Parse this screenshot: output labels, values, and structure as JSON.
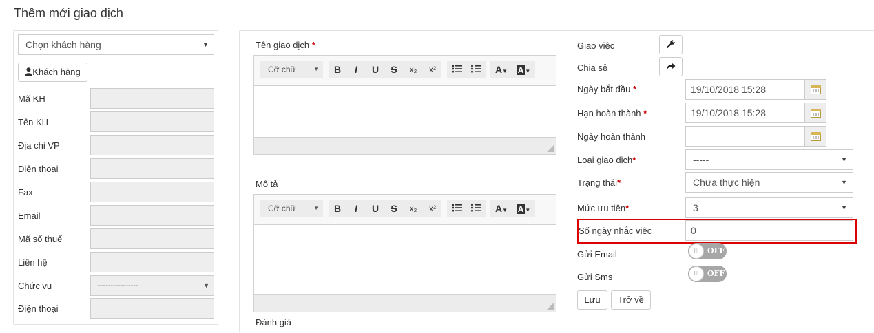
{
  "page": {
    "title": "Thêm mới giao dịch"
  },
  "customer": {
    "select_value": "Chọn khách hàng",
    "button_label": "Khách hàng",
    "fields": [
      {
        "label": "Mã KH"
      },
      {
        "label": "Tên KH"
      },
      {
        "label": "Địa chỉ VP"
      },
      {
        "label": "Điện thoại"
      },
      {
        "label": "Fax"
      },
      {
        "label": "Email"
      },
      {
        "label": "Mã số thuế"
      },
      {
        "label": "Liên hệ"
      },
      {
        "label": "Chức vụ",
        "value": "----------------"
      },
      {
        "label": "Điện thoại"
      }
    ]
  },
  "editors": {
    "name_label": "Tên giao dịch",
    "required_mark": "*",
    "desc_label": "Mô tả",
    "eval_label": "Đánh giá",
    "font_select": "Cỡ chữ",
    "tools": {
      "bold": "B",
      "italic": "I",
      "underline": "U",
      "strike": "S",
      "subscript": "x₂",
      "superscript": "x²",
      "text_color": "A",
      "bg_color": "A"
    }
  },
  "details": {
    "assign_label": "Giao việc",
    "share_label": "Chia sẻ",
    "start_label": "Ngày bắt đầu",
    "start_value": "19/10/2018 15:28",
    "deadline_label": "Hạn hoàn thành",
    "deadline_value": "19/10/2018 15:28",
    "completed_label": "Ngày hoàn thành",
    "completed_value": "",
    "type_label": "Loại giao dịch",
    "type_value": "-----",
    "status_label": "Trạng thái",
    "status_value": "Chưa thực hiện",
    "priority_label": "Mức ưu tiên",
    "priority_value": "3",
    "remind_label": "Số ngày nhắc việc",
    "remind_value": "0",
    "email_label": "Gửi Email",
    "email_toggle": "OFF",
    "sms_label": "Gửi Sms",
    "sms_toggle": "OFF",
    "save_label": "Lưu",
    "back_label": "Trở về"
  },
  "colors": {
    "required": "#cc0000",
    "highlight": "#dd0000",
    "toggle_off": "#a7a7a7"
  }
}
